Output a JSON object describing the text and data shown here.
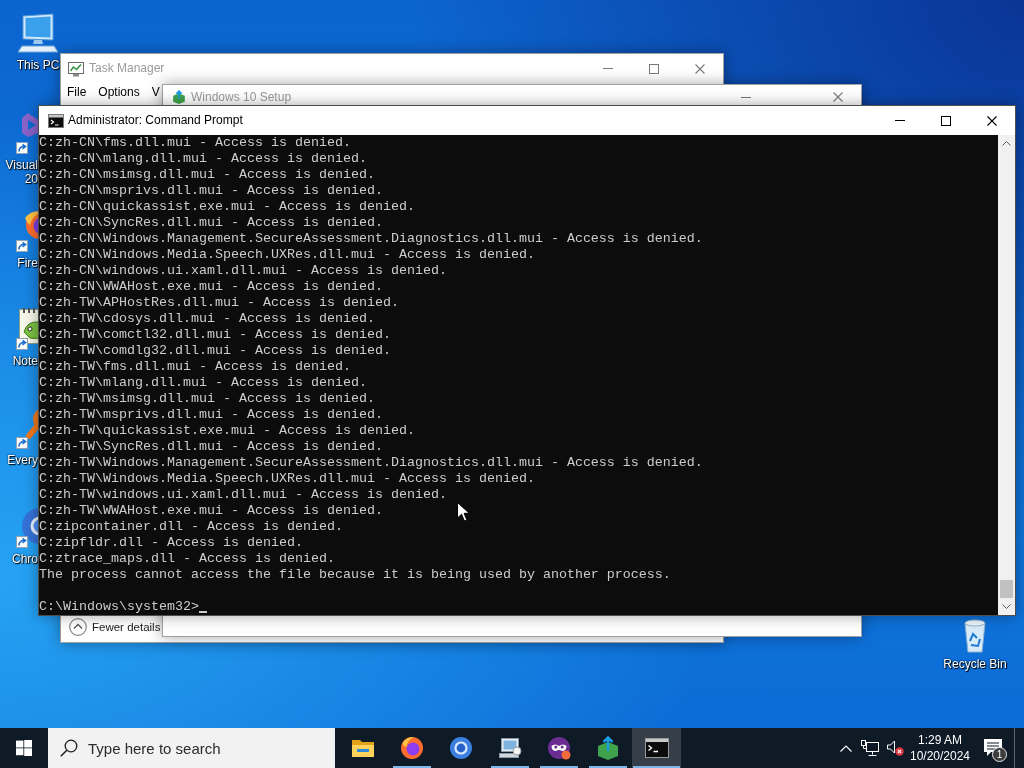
{
  "desktop_icons": [
    {
      "kind": "computer",
      "label": "This PC"
    },
    {
      "kind": "ribbon",
      "label": "Visual 20"
    },
    {
      "kind": "flame-globe",
      "label": "Fire"
    },
    {
      "kind": "notepad",
      "label": "Note"
    },
    {
      "kind": "magnifier",
      "label": "Every"
    },
    {
      "kind": "ring",
      "label": "Chro"
    },
    {
      "kind": "recycle-bin",
      "label": "Recycle Bin"
    }
  ],
  "windows": [
    {
      "kind": "task-manager",
      "title": "Task Manager",
      "active": false,
      "menu": [
        "File",
        "Options",
        "V"
      ],
      "footer": "Fewer details"
    },
    {
      "kind": "setup",
      "title": "Windows 10 Setup",
      "active": false
    },
    {
      "kind": "console",
      "title": "Administrator: Command Prompt",
      "active": true,
      "output_lines": [
        "C:zh-CN\\fms.dll.mui - Access is denied.",
        "C:zh-CN\\mlang.dll.mui - Access is denied.",
        "C:zh-CN\\msimsg.dll.mui - Access is denied.",
        "C:zh-CN\\msprivs.dll.mui - Access is denied.",
        "C:zh-CN\\quickassist.exe.mui - Access is denied.",
        "C:zh-CN\\SyncRes.dll.mui - Access is denied.",
        "C:zh-CN\\Windows.Management.SecureAssessment.Diagnostics.dll.mui - Access is denied.",
        "C:zh-CN\\Windows.Media.Speech.UXRes.dll.mui - Access is denied.",
        "C:zh-CN\\windows.ui.xaml.dll.mui - Access is denied.",
        "C:zh-CN\\WWAHost.exe.mui - Access is denied.",
        "C:zh-TW\\APHostRes.dll.mui - Access is denied.",
        "C:zh-TW\\cdosys.dll.mui - Access is denied.",
        "C:zh-TW\\comctl32.dll.mui - Access is denied.",
        "C:zh-TW\\comdlg32.dll.mui - Access is denied.",
        "C:zh-TW\\fms.dll.mui - Access is denied.",
        "C:zh-TW\\mlang.dll.mui - Access is denied.",
        "C:zh-TW\\msimsg.dll.mui - Access is denied.",
        "C:zh-TW\\msprivs.dll.mui - Access is denied.",
        "C:zh-TW\\quickassist.exe.mui - Access is denied.",
        "C:zh-TW\\SyncRes.dll.mui - Access is denied.",
        "C:zh-TW\\Windows.Management.SecureAssessment.Diagnostics.dll.mui - Access is denied.",
        "C:zh-TW\\Windows.Media.Speech.UXRes.dll.mui - Access is denied.",
        "C:zh-TW\\windows.ui.xaml.dll.mui - Access is denied.",
        "C:zh-TW\\WWAHost.exe.mui - Access is denied.",
        "C:zipcontainer.dll - Access is denied.",
        "C:zipfldr.dll - Access is denied.",
        "C:ztrace_maps.dll - Access is denied.",
        "The process cannot access the file because it is being used by another process."
      ],
      "prompt": "C:\\Windows\\system32>"
    }
  ],
  "taskbar": {
    "search": {
      "placeholder": "Type here to search"
    },
    "apps": [
      {
        "kind": "folder",
        "running": false,
        "active": false
      },
      {
        "kind": "flame-globe",
        "running": true,
        "active": false
      },
      {
        "kind": "ring",
        "running": false,
        "active": false
      },
      {
        "kind": "computer",
        "running": true,
        "active": false
      },
      {
        "kind": "mask",
        "running": true,
        "active": false
      },
      {
        "kind": "setup-box",
        "running": true,
        "active": false
      },
      {
        "kind": "terminal",
        "running": true,
        "active": true
      }
    ],
    "clock": {
      "time": "1:29 AM",
      "date": "10/20/2024"
    },
    "notifications": {
      "count": "1"
    }
  }
}
